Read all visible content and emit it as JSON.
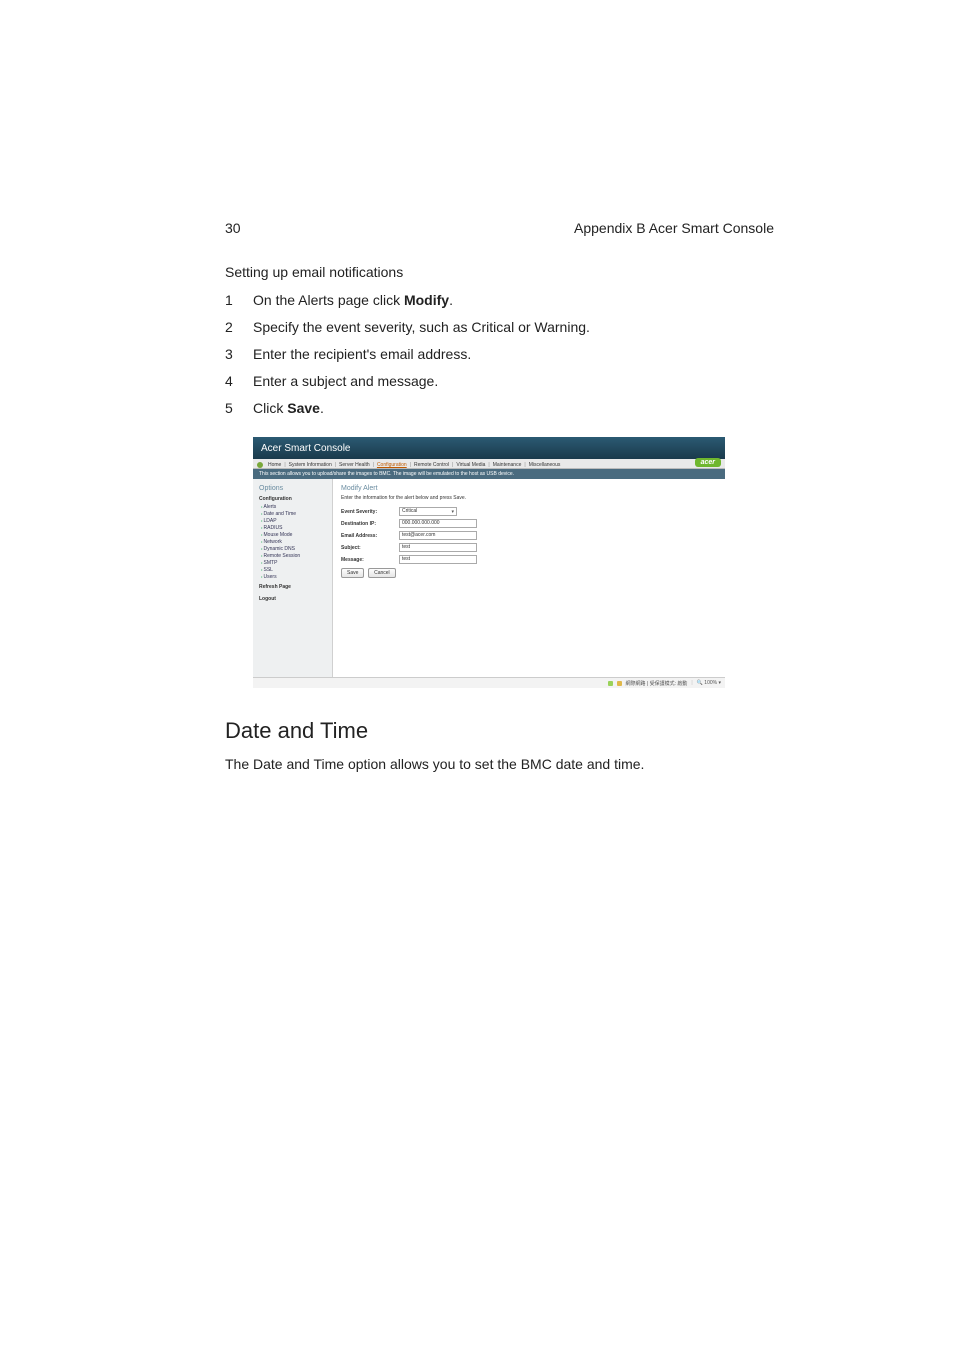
{
  "header": {
    "page_number": "30",
    "appendix": "Appendix B Acer Smart Console"
  },
  "subhead": "Setting up email notifications",
  "steps": {
    "s1_pre": "On the Alerts page click ",
    "s1_bold": "Modify",
    "s1_post": ".",
    "s2": "Specify the event severity, such as Critical or Warning.",
    "s3": "Enter the recipient's email address.",
    "s4": "Enter a subject and message.",
    "s5_pre": "Click ",
    "s5_bold": "Save",
    "s5_post": "."
  },
  "screenshot": {
    "title": "Acer Smart Console",
    "logo": "acer",
    "tabs": {
      "home": "Home",
      "sys": "System Information",
      "health": "Server Health",
      "config": "Configuration",
      "remote": "Remote Control",
      "vmedia": "Virtual Media",
      "maint": "Maintenance",
      "misc": "Miscellaneous"
    },
    "infostrip": "This section allows you to upload/share the images to BMC. The image will be emulated to the host as USB device.",
    "sidebar": {
      "options_title": "Options",
      "group": "Configuration",
      "items": [
        "Alerts",
        "Date and Time",
        "LDAP",
        "RADIUS",
        "Mouse Mode",
        "Network",
        "Dynamic DNS",
        "Remote Session",
        "SMTP",
        "SSL",
        "Users"
      ],
      "refresh": "Refresh Page",
      "logout": "Logout"
    },
    "form": {
      "title": "Modify Alert",
      "desc": "Enter the information for the alert below and press Save.",
      "labels": {
        "severity": "Event Severity:",
        "dest_ip": "Destination IP:",
        "email": "Email Address:",
        "subject": "Subject:",
        "message": "Message:"
      },
      "values": {
        "severity": "Critical",
        "dest_ip": "000.000.000.000",
        "email": "test@acer.com",
        "subject": "test",
        "message": "test"
      },
      "buttons": {
        "save": "Save",
        "cancel": "Cancel"
      }
    },
    "status": {
      "text": "網際網路 | 受保護模式: 啟動",
      "zoom": "100%"
    }
  },
  "section_h2": "Date and Time",
  "section_p": "The Date and Time option allows you to set the BMC date and time."
}
